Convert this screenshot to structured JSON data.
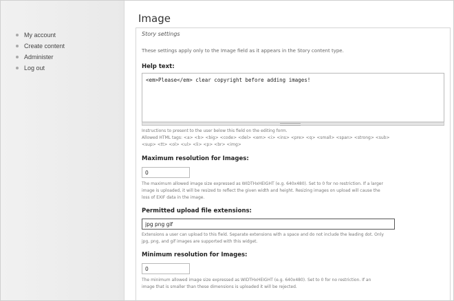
{
  "sidebar": {
    "items": [
      {
        "label": "My account"
      },
      {
        "label": "Create content"
      },
      {
        "label": "Administer"
      },
      {
        "label": "Log out"
      }
    ]
  },
  "page": {
    "title": "Image",
    "legend": "Story settings",
    "intro": "These settings apply only to the Image field as it appears in the Story content type."
  },
  "help_text": {
    "label": "Help text:",
    "value": "<em>Please</em> clear copyright before adding images!",
    "desc1": "Instructions to present to the user below this field on the editing form.",
    "desc2": "Allowed HTML tags: <a> <b> <big> <code> <del> <em> <i> <ins> <pre> <q> <small> <span> <strong> <sub>",
    "desc3": "<sup> <tt> <ol> <ul> <li> <p> <br> <img>"
  },
  "max_resolution": {
    "label": "Maximum resolution for Images:",
    "value": "0",
    "desc1": "The maximum allowed image size expressed as WIDTHxHEIGHT (e.g. 640x480). Set to 0 for no restriction. If a larger",
    "desc2": "image is uploaded, it will be resized to reflect the given width and height. Resizing images on upload will cause the",
    "desc3": "loss of EXIF data in the image."
  },
  "extensions": {
    "label": "Permitted upload file extensions:",
    "value": "jpg png gif",
    "desc1": "Extensions a user can upload to this field. Separate extensions with a space and do not include the leading dot. Only",
    "desc2": "jpg, png, and gif images are supported with this widget."
  },
  "min_resolution": {
    "label": "Minimum resolution for Images:",
    "value": "0",
    "desc1": "The minimum allowed image size expressed as WIDTHxHEIGHT (e.g. 640x480). Set to 0 for no restriction. If an",
    "desc2": "image that is smaller than these dimensions is uploaded it will be rejected."
  }
}
